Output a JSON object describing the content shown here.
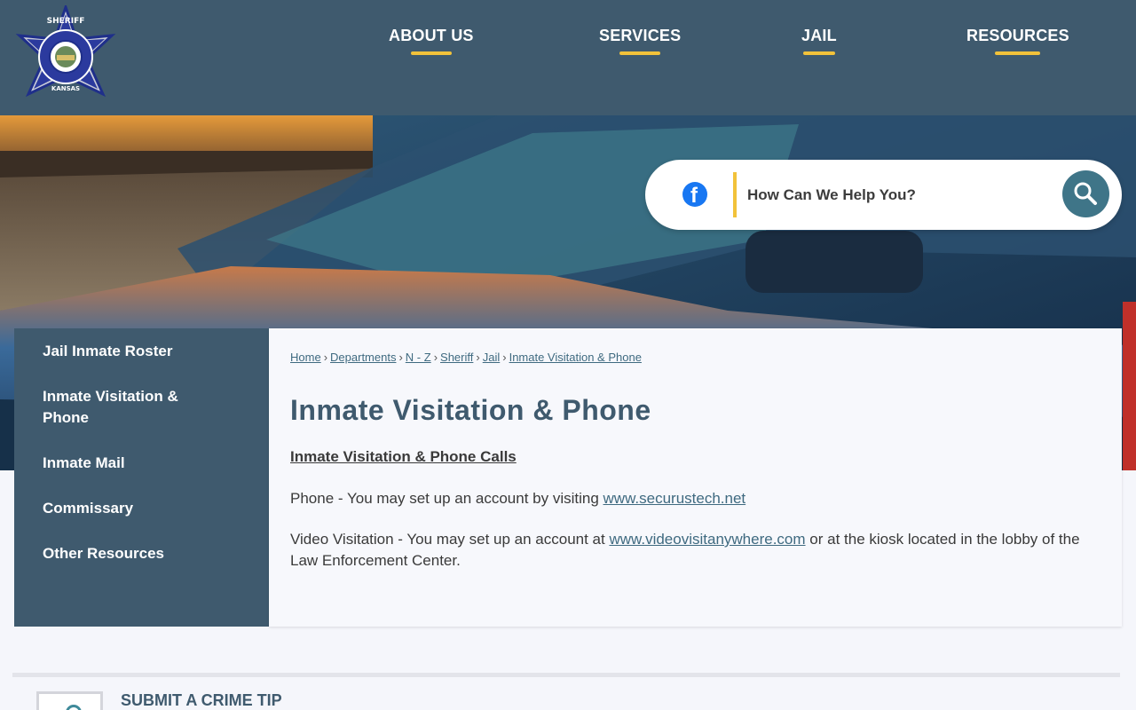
{
  "header": {
    "logo_alt": "McPherson County Sheriff Kansas badge",
    "nav": [
      {
        "label": "ABOUT US"
      },
      {
        "label": "SERVICES"
      },
      {
        "label": "JAIL"
      },
      {
        "label": "RESOURCES"
      }
    ]
  },
  "search": {
    "placeholder": "How Can We Help You?",
    "social_icon": "facebook-icon",
    "button_icon": "search-icon"
  },
  "sidebar": {
    "items": [
      {
        "label": "Jail Inmate Roster"
      },
      {
        "label": "Inmate Visitation & Phone"
      },
      {
        "label": "Inmate Mail"
      },
      {
        "label": "Commissary"
      },
      {
        "label": "Other Resources"
      }
    ]
  },
  "breadcrumb": {
    "items": [
      "Home",
      "Departments",
      "N - Z",
      "Sheriff",
      "Jail",
      "Inmate Visitation & Phone"
    ],
    "separator": "›"
  },
  "main": {
    "title": "Inmate Visitation & Phone",
    "subheading": "Inmate Visitation & Phone Calls",
    "phone_text": "Phone - You may set up an account by visiting ",
    "phone_link": "www.securustech.net",
    "video_text": "Video Visitation -  You may set up an account at ",
    "video_link": "www.videovisitanywhere.com",
    "video_text_after": " or at the kiosk located in the lobby of the Law Enforcement Center."
  },
  "footer": {
    "crime_tip_label": "SUBMIT A CRIME TIP"
  },
  "colors": {
    "brand": "#3f5a6e",
    "accent": "#f2c23a",
    "link": "#3f6a80",
    "search_button": "#3f7588"
  }
}
